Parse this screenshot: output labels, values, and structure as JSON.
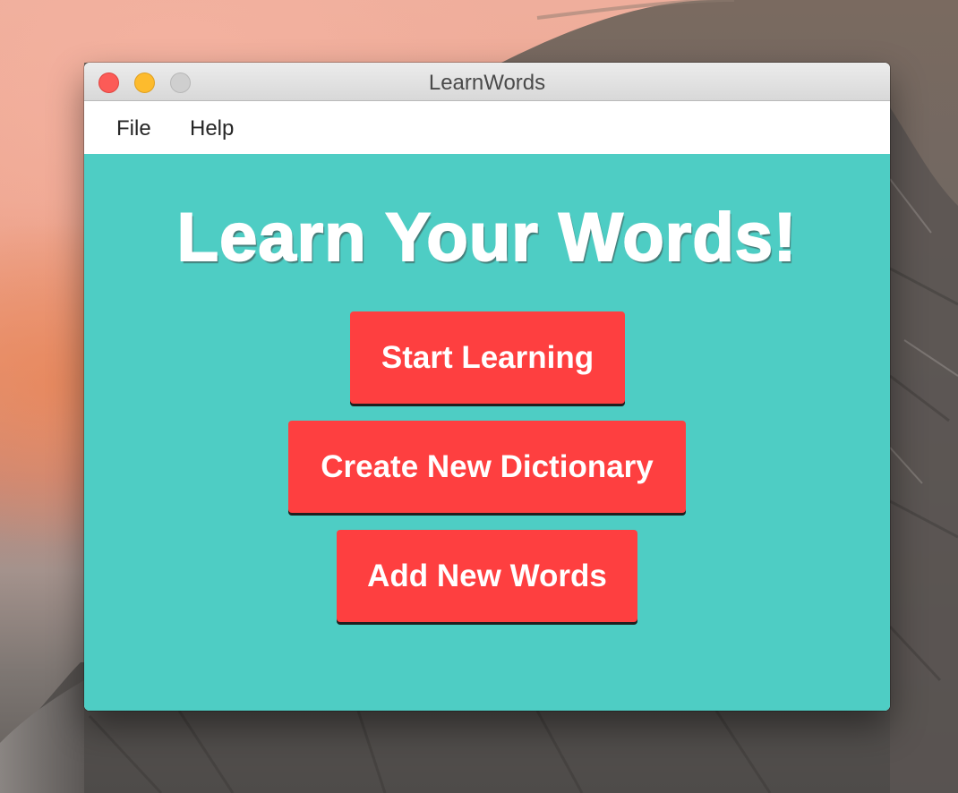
{
  "window": {
    "title": "LearnWords"
  },
  "menu": {
    "file": "File",
    "help": "Help"
  },
  "main": {
    "headline": "Learn Your Words!",
    "buttons": {
      "start": "Start Learning",
      "create": "Create New Dictionary",
      "add": "Add New Words"
    }
  },
  "colors": {
    "content_bg": "#4ecdc4",
    "button_bg": "#fe3f40",
    "button_text": "#ffffff",
    "close": "#fc5b57",
    "minimize": "#fdbb2d",
    "zoom": "#cfcfcf"
  },
  "icons": {
    "close": "close-icon",
    "minimize": "minimize-icon",
    "zoom": "zoom-icon"
  }
}
